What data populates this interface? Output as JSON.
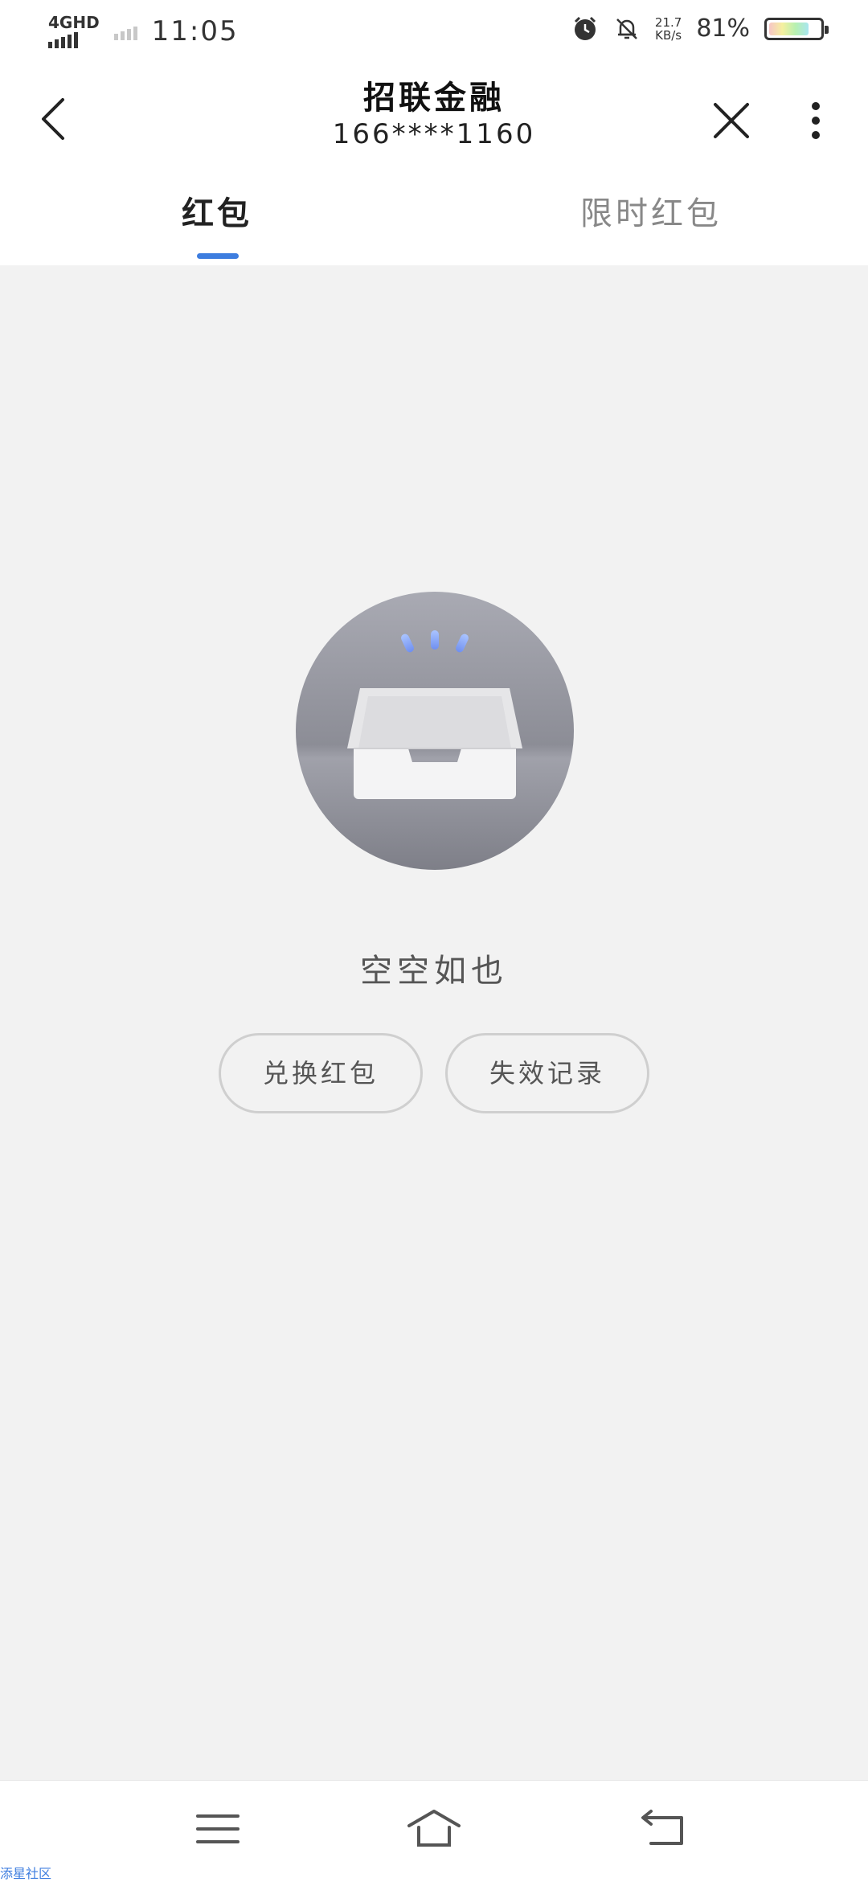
{
  "status_bar": {
    "network": "4GHD",
    "time": "11:05",
    "speed_value": "21.7",
    "speed_unit": "KB/s",
    "battery": "81%",
    "battery_level": 0.81
  },
  "header": {
    "title": "招联金融",
    "subtitle": "166****1160"
  },
  "tabs": [
    {
      "label": "红包",
      "active": true
    },
    {
      "label": "限时红包",
      "active": false
    }
  ],
  "empty_state": {
    "message": "空空如也",
    "redeem_button": "兑换红包",
    "history_button": "失效记录"
  },
  "watermark": "添星社区",
  "colors": {
    "accent": "#3d7ddf",
    "background": "#f2f2f2"
  }
}
